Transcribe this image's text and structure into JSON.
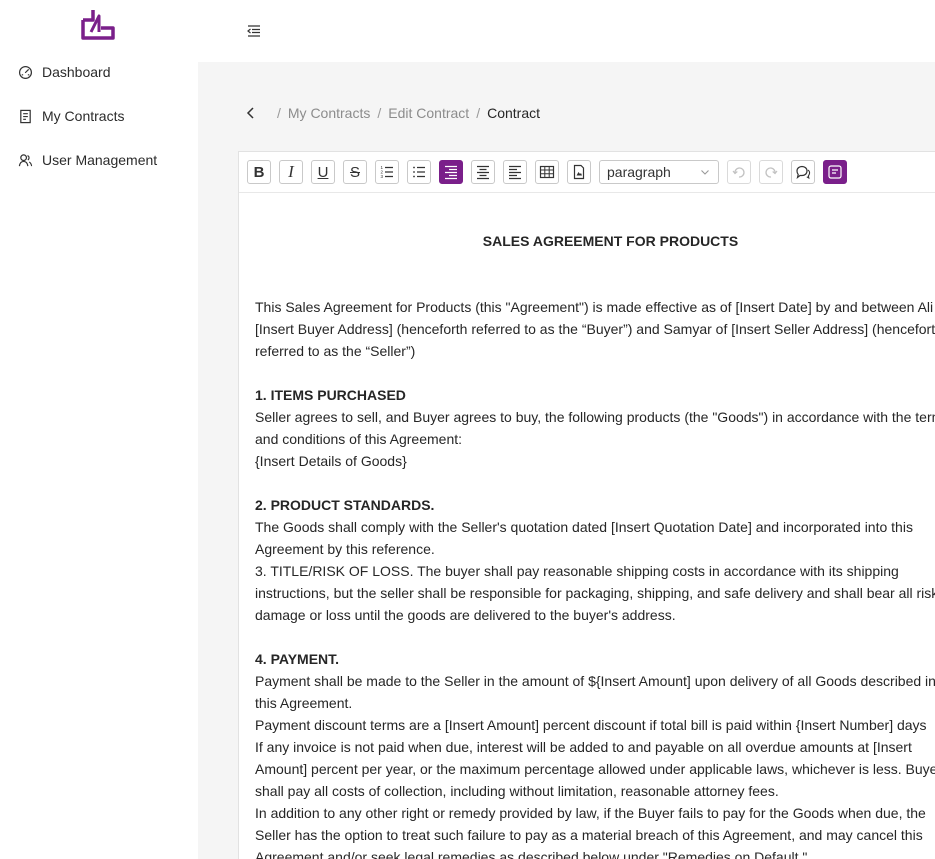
{
  "sidebar": {
    "items": [
      {
        "label": "Dashboard",
        "icon": "dashboard-icon"
      },
      {
        "label": "My Contracts",
        "icon": "contract-icon"
      },
      {
        "label": "User Management",
        "icon": "users-icon"
      }
    ]
  },
  "colors": {
    "accent": "#7a1f8a",
    "content_bg": "#f5f5f5"
  },
  "breadcrumb": {
    "items": [
      "My Contracts",
      "Edit Contract",
      "Contract"
    ],
    "separator": "/"
  },
  "toolbar": {
    "buttons": {
      "bold": "B",
      "italic": "I",
      "underline": "U",
      "strikethrough": "S"
    },
    "block_format": "paragraph"
  },
  "document": {
    "title": "SALES AGREEMENT FOR PRODUCTS",
    "lines": [
      "This Sales Agreement for Products (this \"Agreement\") is made effective as of [Insert Date] by and between Ali",
      "[Insert Buyer Address] (henceforth referred to as the “Buyer”) and Samyar of [Insert Seller Address] (henceforth",
      "referred to as the “Seller”)",
      "",
      "1. ITEMS PURCHASED",
      "Seller agrees to sell, and Buyer agrees to buy, the following products (the \"Goods\") in accordance with the terms",
      "and conditions of this Agreement:",
      "{Insert Details of Goods}",
      "",
      "2. PRODUCT STANDARDS.",
      "The Goods shall comply with the Seller's quotation dated [Insert Quotation Date] and incorporated into this",
      "Agreement by this reference.",
      "3. TITLE/RISK OF LOSS. The buyer shall pay reasonable shipping costs in accordance with its shipping",
      "instructions, but the seller shall be responsible for packaging, shipping, and safe delivery and shall bear all risk",
      "damage or loss until the goods are delivered to the buyer's address.",
      "",
      "4. PAYMENT.",
      "Payment shall be made to the Seller in the amount of ${Insert Amount] upon delivery of all Goods described in",
      "this Agreement.",
      "Payment discount terms are a [Insert Amount] percent discount if total bill is paid within {Insert Number] days",
      "If any invoice is not paid when due, interest will be added to and payable on all overdue amounts at [Insert",
      "Amount] percent per year, or the maximum percentage allowed under applicable laws, whichever is less. Buyer",
      "shall pay all costs of collection, including without limitation, reasonable attorney fees.",
      "In addition to any other right or remedy provided by law, if the Buyer fails to pay for the Goods when due, the",
      "Seller has the option to treat such failure to pay as a material breach of this Agreement, and may cancel this",
      "Agreement and/or seek legal remedies as described below under \"Remedies on Default.\""
    ],
    "heading_lines": [
      4,
      9,
      16
    ]
  }
}
